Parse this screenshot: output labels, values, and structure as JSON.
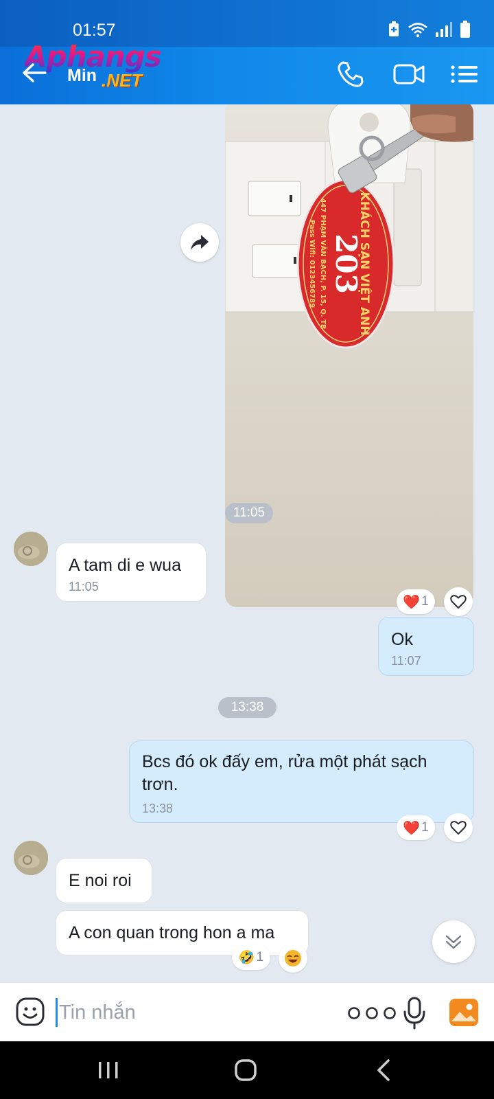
{
  "status_bar": {
    "time": "01:57"
  },
  "header": {
    "logo": {
      "top": "Aphangs",
      "min": "Min",
      "net": ".NET"
    }
  },
  "chat": {
    "photo_key_tag": {
      "hotel": "KHÁCH SẠN VIỆT ANH",
      "room": "203",
      "address": "447 PHẠM VĂN BẠCH, P. 15, Q. TB",
      "wifi": "Pass Wifi: 0123456789"
    },
    "photo_reaction": {
      "emoji": "❤️",
      "count": "1"
    },
    "separator_1": "11:05",
    "msg_1": {
      "text": "A tam di e wua",
      "time": "11:05"
    },
    "msg_2": {
      "text": "Ok",
      "time": "11:07"
    },
    "separator_2": "13:38",
    "msg_3": {
      "text": "Bcs đó ok đấy em, rửa một phát sạch trơn.",
      "time": "13:38"
    },
    "msg_3_reaction": {
      "emoji": "❤️",
      "count": "1"
    },
    "msg_4": {
      "text": "E noi roi"
    },
    "msg_5": {
      "text": "A con quan trong hon a ma"
    },
    "msg_5_reaction": {
      "emoji": "🤣",
      "count": "1"
    }
  },
  "input": {
    "placeholder": "Tin nhắn"
  }
}
